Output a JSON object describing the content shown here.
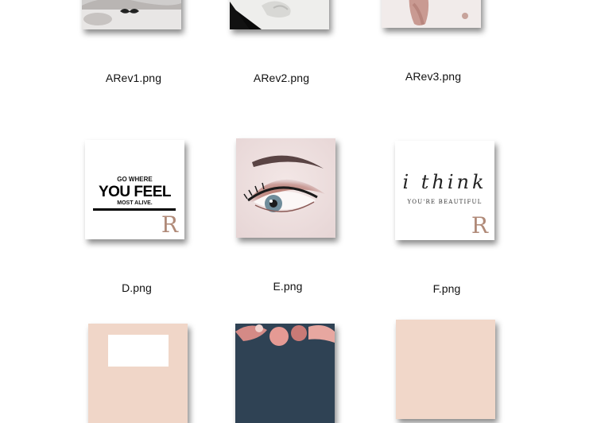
{
  "files": [
    {
      "name": "ARev1.png",
      "icon": "hand-mustache-image-thumbnail"
    },
    {
      "name": "ARev2.png",
      "icon": "white-black-art-thumbnail"
    },
    {
      "name": "ARev3.png",
      "icon": "pink-swatch-thumbnail"
    },
    {
      "name": "D.png",
      "icon": "quote-poster-thumbnail",
      "poster": {
        "line1": "GO WHERE",
        "line2": "YOU FEEL",
        "line3": "MOST ALIVE.",
        "logo": "R"
      }
    },
    {
      "name": "E.png",
      "icon": "eye-makeup-photo-thumbnail"
    },
    {
      "name": "F.png",
      "icon": "quote-poster-thumbnail",
      "poster": {
        "line1": "i think",
        "line2": "YOU'RE BEAUTIFUL",
        "logo": "R"
      }
    },
    {
      "name": "",
      "icon": "peach-poster-thumbnail"
    },
    {
      "name": "",
      "icon": "pink-hair-photo-thumbnail"
    },
    {
      "name": "",
      "icon": "peach-tile-thumbnail"
    }
  ]
}
